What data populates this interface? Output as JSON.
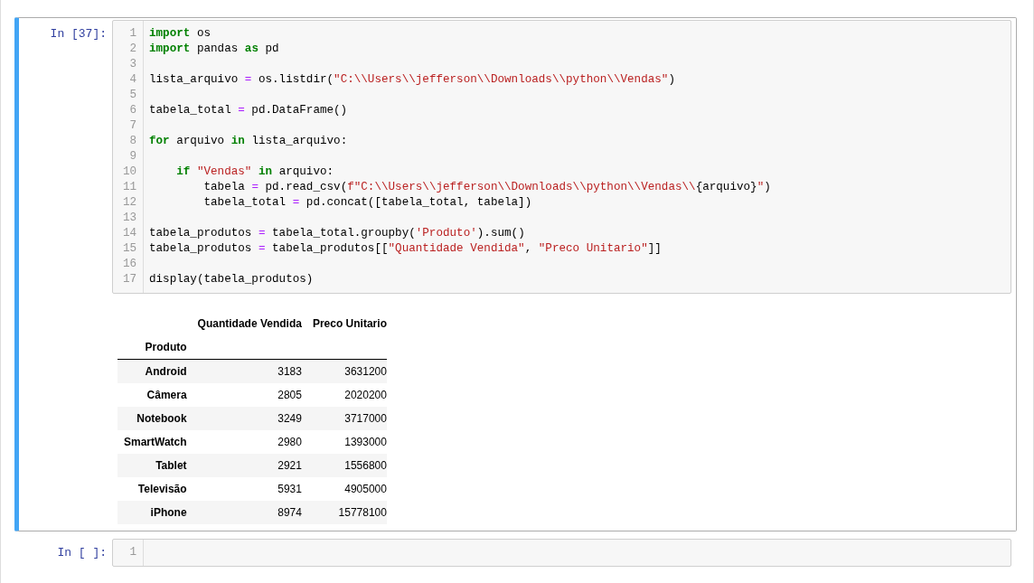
{
  "cells": [
    {
      "prompt": "In [37]:",
      "selected": true,
      "lines": [
        {
          "number": "1",
          "tokens": [
            {
              "kind": "keyword",
              "text": "import"
            },
            {
              "kind": "plain",
              "text": " os"
            }
          ]
        },
        {
          "number": "2",
          "tokens": [
            {
              "kind": "keyword",
              "text": "import"
            },
            {
              "kind": "plain",
              "text": " pandas "
            },
            {
              "kind": "keyword",
              "text": "as"
            },
            {
              "kind": "plain",
              "text": " pd"
            }
          ]
        },
        {
          "number": "3"
        },
        {
          "number": "4",
          "tokens": [
            {
              "kind": "plain",
              "text": "lista_arquivo "
            },
            {
              "kind": "operator",
              "text": "="
            },
            {
              "kind": "plain",
              "text": " os.listdir("
            },
            {
              "kind": "string",
              "text": "\"C:\\\\Users\\\\jefferson\\\\Downloads\\\\python\\\\Vendas\""
            },
            {
              "kind": "plain",
              "text": ")"
            }
          ]
        },
        {
          "number": "5"
        },
        {
          "number": "6",
          "tokens": [
            {
              "kind": "plain",
              "text": "tabela_total "
            },
            {
              "kind": "operator",
              "text": "="
            },
            {
              "kind": "plain",
              "text": " pd.DataFrame()"
            }
          ]
        },
        {
          "number": "7"
        },
        {
          "number": "8",
          "tokens": [
            {
              "kind": "keyword",
              "text": "for"
            },
            {
              "kind": "plain",
              "text": " arquivo "
            },
            {
              "kind": "keyword",
              "text": "in"
            },
            {
              "kind": "plain",
              "text": " lista_arquivo:"
            }
          ]
        },
        {
          "number": "9"
        },
        {
          "number": "10",
          "tokens": [
            {
              "kind": "keyword",
              "text": "    if"
            },
            {
              "kind": "string",
              "text": " \"Vendas\""
            },
            {
              "kind": "keyword",
              "text": " in"
            },
            {
              "kind": "plain",
              "text": " arquivo:"
            }
          ]
        },
        {
          "number": "11",
          "tokens": [
            {
              "kind": "plain",
              "text": "        tabela "
            },
            {
              "kind": "operator",
              "text": "="
            },
            {
              "kind": "plain",
              "text": " pd.read_csv("
            },
            {
              "kind": "string",
              "text": "f\"C:\\\\Users\\\\jefferson\\\\Downloads\\\\python\\\\Vendas\\\\"
            },
            {
              "kind": "plain",
              "text": "{arquivo}"
            },
            {
              "kind": "string",
              "text": "\""
            },
            {
              "kind": "plain",
              "text": ")"
            }
          ]
        },
        {
          "number": "12",
          "tokens": [
            {
              "kind": "plain",
              "text": "        tabela_total "
            },
            {
              "kind": "operator",
              "text": "="
            },
            {
              "kind": "plain",
              "text": " pd.concat([tabela_total, tabela])"
            }
          ]
        },
        {
          "number": "13"
        },
        {
          "number": "14",
          "tokens": [
            {
              "kind": "plain",
              "text": "tabela_produtos "
            },
            {
              "kind": "operator",
              "text": "="
            },
            {
              "kind": "plain",
              "text": " tabela_total.groupby("
            },
            {
              "kind": "string",
              "text": "'Produto'"
            },
            {
              "kind": "plain",
              "text": ").sum()"
            }
          ]
        },
        {
          "number": "15",
          "tokens": [
            {
              "kind": "plain",
              "text": "tabela_produtos "
            },
            {
              "kind": "operator",
              "text": "="
            },
            {
              "kind": "plain",
              "text": " tabela_produtos[["
            },
            {
              "kind": "string",
              "text": "\"Quantidade Vendida\""
            },
            {
              "kind": "plain",
              "text": ", "
            },
            {
              "kind": "string",
              "text": "\"Preco Unitario\""
            },
            {
              "kind": "plain",
              "text": "]]"
            }
          ]
        },
        {
          "number": "16"
        },
        {
          "number": "17",
          "tokens": [
            {
              "kind": "plain",
              "text": "display(tabela_produtos)"
            }
          ]
        }
      ],
      "output": {
        "table": {
          "columns": [
            "Quantidade Vendida",
            "Preco Unitario"
          ],
          "index_name": "Produto",
          "rows": [
            {
              "label": "Android",
              "values": [
                "3183",
                "3631200"
              ]
            },
            {
              "label": "Câmera",
              "values": [
                "2805",
                "2020200"
              ]
            },
            {
              "label": "Notebook",
              "values": [
                "3249",
                "3717000"
              ]
            },
            {
              "label": "SmartWatch",
              "values": [
                "2980",
                "1393000"
              ]
            },
            {
              "label": "Tablet",
              "values": [
                "2921",
                "1556800"
              ]
            },
            {
              "label": "Televisão",
              "values": [
                "5931",
                "4905000"
              ]
            },
            {
              "label": "iPhone",
              "values": [
                "8974",
                "15778100"
              ]
            }
          ]
        }
      }
    },
    {
      "prompt": "In [ ]:",
      "selected": false,
      "lines": [
        {
          "number": "1"
        }
      ]
    }
  ]
}
